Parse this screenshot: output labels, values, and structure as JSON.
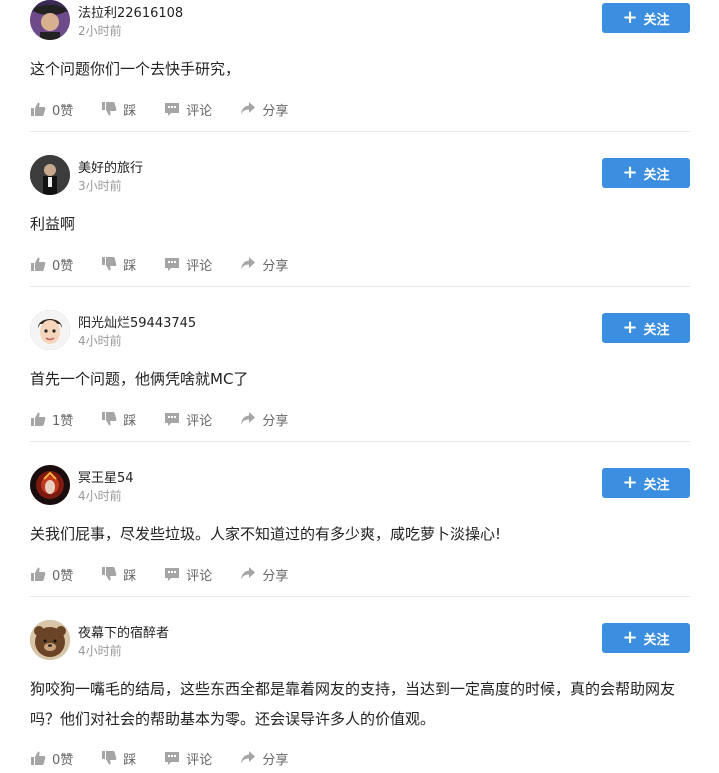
{
  "follow_label": "关注",
  "colors": {
    "accent": "#3b8ee0",
    "icon_gray": "#a5a5a5",
    "divider": "#e8e8e8"
  },
  "comments": [
    {
      "username": "法拉利22616108",
      "time": "2小时前",
      "content": "这个问题你们一个去快手研究，",
      "likes": "0赞",
      "dislike": "踩",
      "reply": "评论",
      "share": "分享"
    },
    {
      "username": "美好的旅行",
      "time": "3小时前",
      "content": "利益啊",
      "likes": "0赞",
      "dislike": "踩",
      "reply": "评论",
      "share": "分享"
    },
    {
      "username": "阳光灿烂59443745",
      "time": "4小时前",
      "content": "首先一个问题，他俩凭啥就MC了",
      "likes": "1赞",
      "dislike": "踩",
      "reply": "评论",
      "share": "分享"
    },
    {
      "username": "冥王星54",
      "time": "4小时前",
      "content": "关我们屁事，尽发些垃圾。人家不知道过的有多少爽，咸吃萝卜淡操心!",
      "likes": "0赞",
      "dislike": "踩",
      "reply": "评论",
      "share": "分享"
    },
    {
      "username": "夜幕下的宿醉者",
      "time": "4小时前",
      "content": "狗咬狗一嘴毛的结局，这些东西全都是靠着网友的支持，当达到一定高度的时候，真的会帮助网友吗？他们对社会的帮助基本为零。还会误导许多人的价值观。",
      "likes": "0赞",
      "dislike": "踩",
      "reply": "评论",
      "share": "分享"
    }
  ]
}
